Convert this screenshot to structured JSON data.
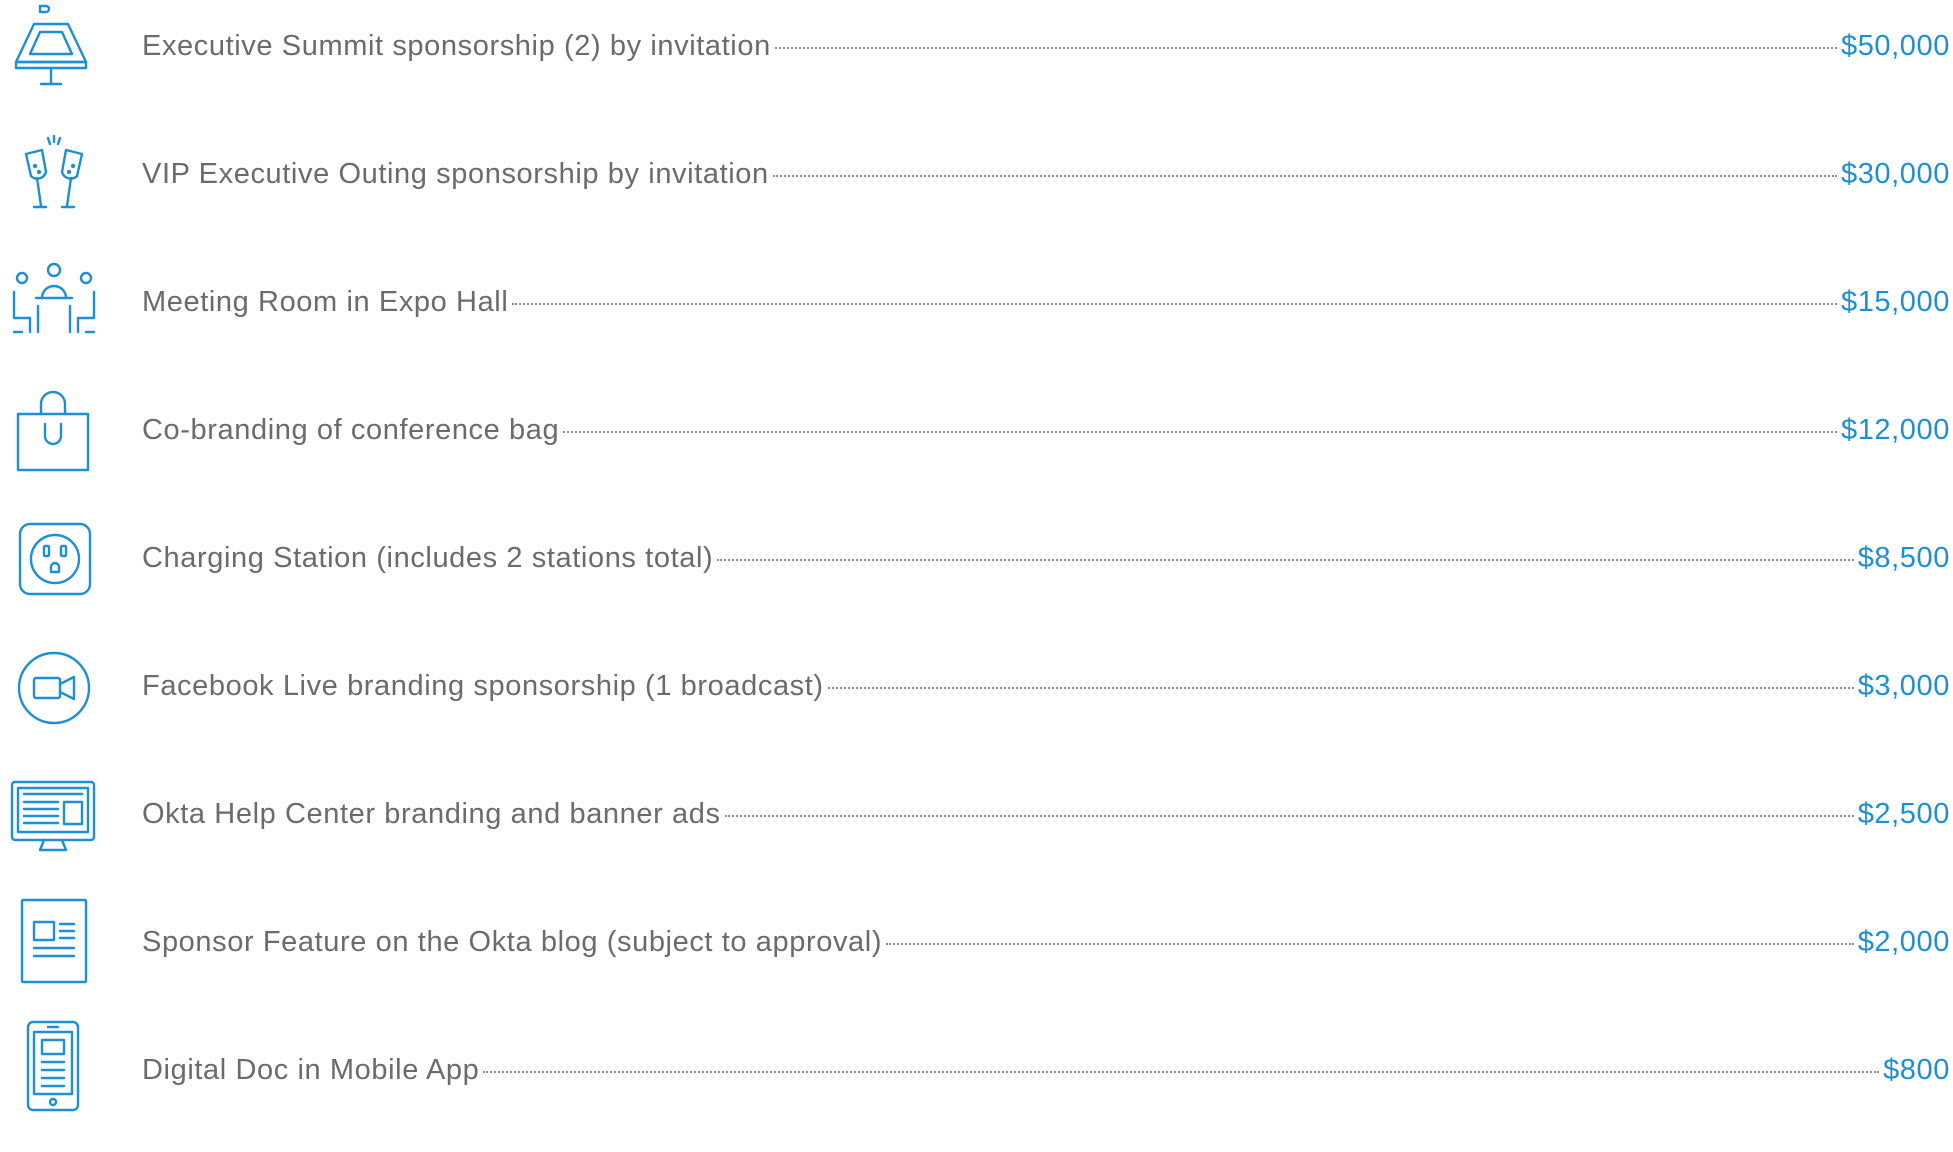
{
  "colors": {
    "accent": "#1d8fd2",
    "label_text": "#6b6b6b",
    "leader_dots": "#8e8e8e",
    "icon_stroke": "#1d8fd2"
  },
  "items": [
    {
      "icon": "podium-icon",
      "label": "Executive Summit sponsorship (2) by invitation",
      "price": "$50,000"
    },
    {
      "icon": "champagne-toast-icon",
      "label": "VIP Executive Outing sponsorship by invitation",
      "price": "$30,000"
    },
    {
      "icon": "meeting-room-icon",
      "label": "Meeting Room in Expo Hall",
      "price": "$15,000"
    },
    {
      "icon": "shopping-bag-icon",
      "label": "Co-branding of conference bag",
      "price": "$12,000"
    },
    {
      "icon": "power-outlet-icon",
      "label": "Charging Station (includes 2 stations total)",
      "price": "$8,500"
    },
    {
      "icon": "video-camera-icon",
      "label": "Facebook Live branding sponsorship (1 broadcast)",
      "price": "$3,000"
    },
    {
      "icon": "monitor-icon",
      "label": "Okta Help Center branding and banner ads",
      "price": "$2,500"
    },
    {
      "icon": "document-icon",
      "label": "Sponsor Feature on the Okta blog (subject to approval)",
      "price": "$2,000"
    },
    {
      "icon": "mobile-phone-icon",
      "label": "Digital Doc in Mobile App",
      "price": "$800"
    }
  ]
}
